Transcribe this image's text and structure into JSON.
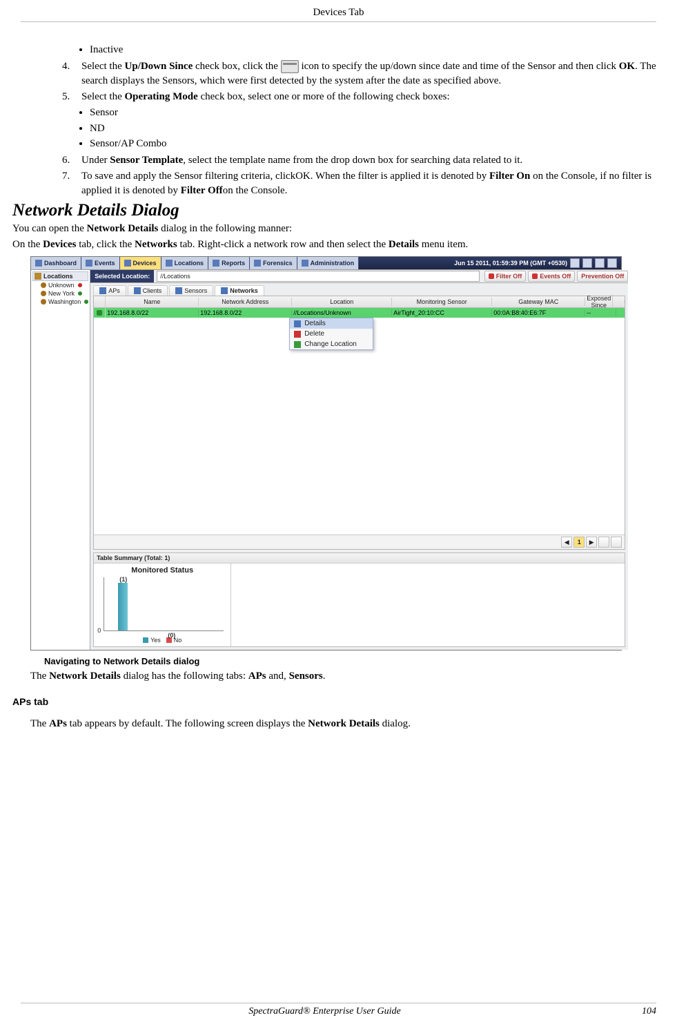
{
  "page_header": "Devices Tab",
  "list_pre": {
    "inactive": "Inactive"
  },
  "step4": {
    "num": "4.",
    "t1": "Select the ",
    "b1": "Up/Down Since",
    "t2": " check box, click the ",
    "icon_name": "calendar-icon",
    "t3": " icon to specify the up/down since date and time of the Sensor and then click ",
    "b2": "OK",
    "t4": ". The search displays the Sensors, which were first detected by the system after the date as specified above."
  },
  "step5": {
    "num": "5.",
    "t1": "Select the ",
    "b1": "Operating Mode",
    "t2": " check box, select one or more of the following check boxes:",
    "opts": {
      "sensor": "Sensor",
      "nd": "ND",
      "combo": "Sensor/AP Combo"
    }
  },
  "step6": {
    "num": "6.",
    "t1": "Under ",
    "b1": "Sensor Template",
    "t2": ", select the template name from the drop down box for searching data related to it."
  },
  "step7": {
    "num": "7.",
    "t1": "To save and apply the Sensor filtering criteria, clickOK. When the filter is applied it is denoted by ",
    "b1": "Filter On",
    "t2": " on the Console, if no filter is applied it is denoted by ",
    "b2": "Filter Off",
    "t3": "on the Console."
  },
  "h2": "Network Details Dialog",
  "p1": {
    "t1": "You can open the ",
    "b1": "Network Details",
    "t2": " dialog in the following manner:"
  },
  "p2": {
    "t1": "On the ",
    "b1": "Devices",
    "t2": " tab, click the ",
    "b2": "Networks",
    "t3": " tab. Right-click a network row and then select the ",
    "b3": "Details",
    "t4": " menu item."
  },
  "shot": {
    "top_tabs": {
      "dashboard": "Dashboard",
      "events": "Events",
      "devices": "Devices",
      "locations": "Locations",
      "reports": "Reports",
      "forensics": "Forensics",
      "admin": "Administration"
    },
    "datetime": "Jun 15 2011, 01:59:39 PM (GMT +0530)",
    "tree": {
      "root": "Locations",
      "items": [
        "Unknown",
        "New York",
        "Washington"
      ]
    },
    "locbar": {
      "label": "Selected Location:",
      "path": "//Locations",
      "filter": "Filter Off",
      "events": "Events Off",
      "prevention": "Prevention Off"
    },
    "subtabs": {
      "aps": "APs",
      "clients": "Clients",
      "sensors": "Sensors",
      "networks": "Networks"
    },
    "columns": [
      "Name",
      "Network Address",
      "Location",
      "Monitoring Sensor",
      "Gateway MAC",
      "Exposed Since"
    ],
    "row": {
      "name": "192.168.8.0/22",
      "addr": "192.168.8.0/22",
      "loc": "//Locations/Unknown",
      "sensor": "AirTight_20:10:CC",
      "mac": "00:0A:B8:40:E6:7F",
      "since": "--"
    },
    "ctx": {
      "details": "Details",
      "delete": "Delete",
      "change": "Change Location"
    },
    "pager": {
      "prev": "◀",
      "page": "1",
      "next": "▶"
    },
    "summary_title": "Table Summary (Total: 1)",
    "chart": {
      "title": "Monitored Status",
      "val1": "(1)",
      "val0": "(0)",
      "axis0": "0",
      "legend_yes": "Yes",
      "legend_no": "No"
    }
  },
  "chart_data": {
    "type": "bar",
    "title": "Monitored Status",
    "categories": [
      "Yes",
      "No"
    ],
    "values": [
      1,
      0
    ],
    "ylim": [
      0,
      1
    ],
    "legend": [
      "Yes",
      "No"
    ],
    "colors": {
      "Yes": "#3b9ab0",
      "No": "#d94b4b"
    }
  },
  "caption": "Navigating to Network Details dialog",
  "p3": {
    "t1": "The ",
    "b1": "Network Details",
    "t2": " dialog has the following tabs: ",
    "b2": "APs",
    "t3": " and, ",
    "b3": "Sensors",
    "t4": "."
  },
  "h3": "APs tab",
  "p4": {
    "t1": "The ",
    "b1": "APs",
    "t2": " tab appears by default. The following screen displays the ",
    "b2": "Network Details",
    "t3": " dialog."
  },
  "footer": {
    "title": "SpectraGuard®  Enterprise User Guide",
    "page": "104"
  }
}
